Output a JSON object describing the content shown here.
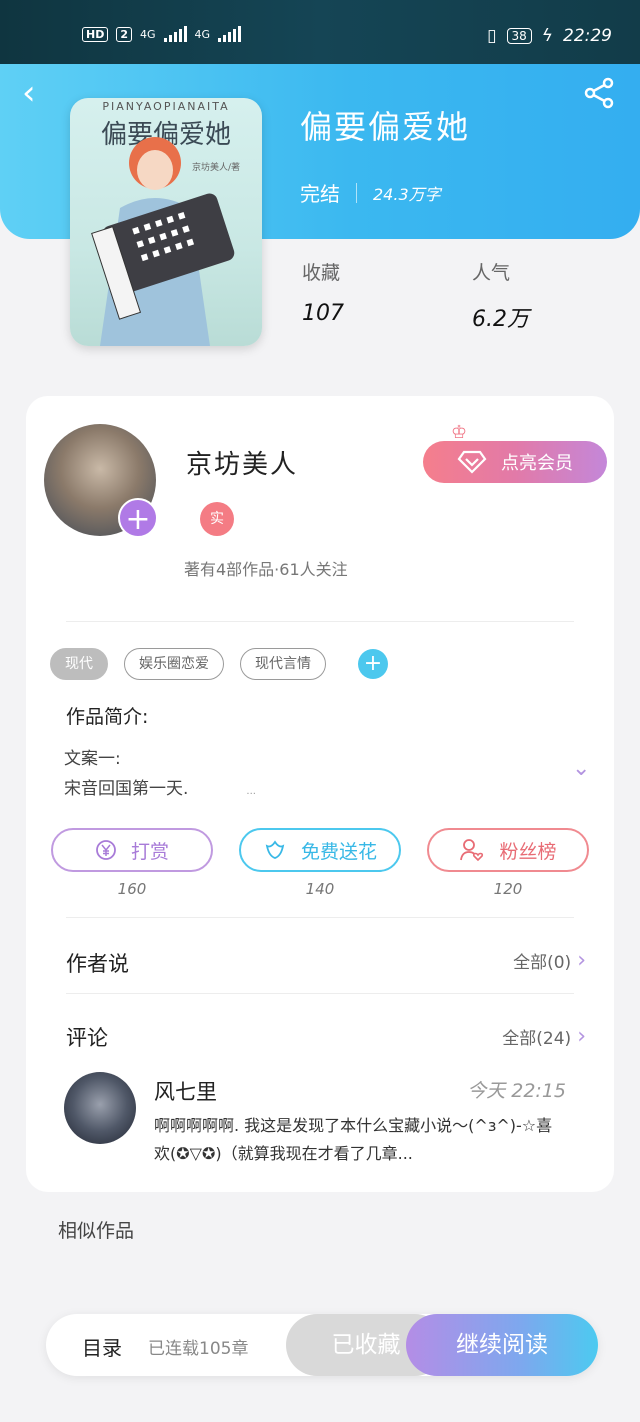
{
  "status_bar": {
    "hd": "HD",
    "sim": "2",
    "net1": "4G",
    "net2": "4G",
    "battery": "38",
    "time": "22:29"
  },
  "book": {
    "title": "偏要偏爱她",
    "status": "完结",
    "word_count": "24.3万字",
    "cover": {
      "pinyin": "PIANYAOPIANAITA",
      "title": "偏要偏爱她",
      "author_note": "京坊美人/著"
    }
  },
  "stats": {
    "favorites_label": "收藏",
    "favorites_value": "107",
    "popularity_label": "人气",
    "popularity_value": "6.2万"
  },
  "author": {
    "name": "京坊美人",
    "badge": "实",
    "stats_text": "著有4部作品·61人关注",
    "vip_label": "点亮会员"
  },
  "tags": [
    "现代",
    "娱乐圈恋爱",
    "现代言情"
  ],
  "intro": {
    "title": "作品简介:",
    "line1": "文案一:",
    "line2": "宋音回国第一天.",
    "ellipsis": "..."
  },
  "actions": [
    {
      "label": "打赏",
      "count": "160"
    },
    {
      "label": "免费送花",
      "count": "140"
    },
    {
      "label": "粉丝榜",
      "count": "120"
    }
  ],
  "author_says": {
    "title": "作者说",
    "more": "全部(0)"
  },
  "comments": {
    "title": "评论",
    "more": "全部(24)",
    "items": [
      {
        "user": "风七里",
        "time": "今天 22:15",
        "text": "啊啊啊啊啊. 我这是发现了本什么宝藏小说～(^з^)-☆喜欢(✪▽✪)（就算我现在才看了几章..."
      }
    ]
  },
  "similar": {
    "title": "相似作品"
  },
  "bottom_bar": {
    "toc": "目录",
    "serial": "已连载105章",
    "collected": "已收藏",
    "continue": "继续阅读"
  },
  "colors": {
    "hero": "#3bb8f0",
    "accent_purple": "#b07ae6",
    "accent_blue": "#4cc8ee",
    "accent_pink": "#f08a90"
  }
}
